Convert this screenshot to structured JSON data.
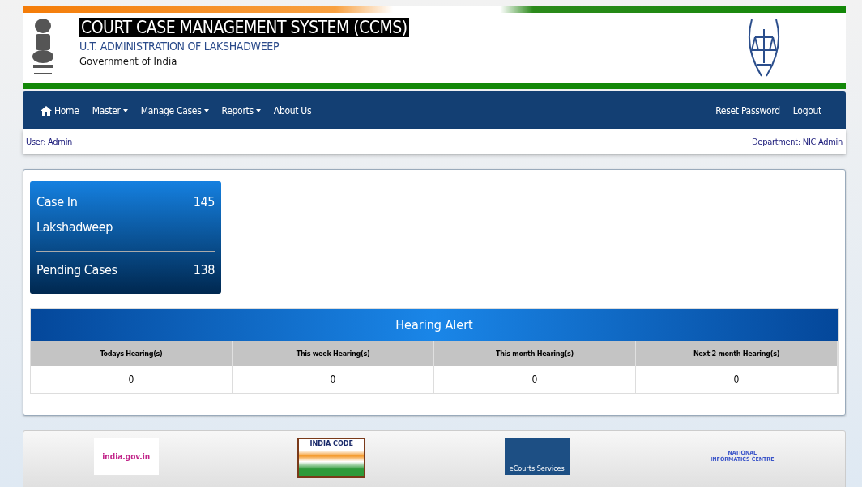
{
  "header": {
    "title": "COURT CASE MANAGEMENT SYSTEM (CCMS)",
    "subtitle": "U.T. ADMINISTRATION OF LAKSHADWEEP",
    "government": "Government of India"
  },
  "nav": {
    "left": [
      {
        "label": "Home",
        "kind": "home"
      },
      {
        "label": "Master",
        "kind": "dropdown"
      },
      {
        "label": "Manage Cases",
        "kind": "dropdown"
      },
      {
        "label": "Reports",
        "kind": "dropdown"
      },
      {
        "label": "About Us",
        "kind": "link"
      }
    ],
    "right": [
      {
        "label": "Reset Password"
      },
      {
        "label": "Logout"
      }
    ]
  },
  "user_bar": {
    "user": "User: Admin",
    "department": "Department: NIC Admin"
  },
  "stats": [
    {
      "label": "Case In Lakshadweep",
      "value": "145"
    },
    {
      "label": "Pending Cases",
      "value": "138"
    }
  ],
  "hearing_alert": {
    "title": "Hearing Alert",
    "columns": [
      "Todays Hearing(s)",
      "This week Hearing(s)",
      "This month Hearing(s)",
      "Next 2 month Hearing(s)"
    ],
    "values": [
      "0",
      "0",
      "0",
      "0"
    ]
  },
  "footer_logos": [
    {
      "kind": "indiagov",
      "text": "india.gov.in"
    },
    {
      "kind": "indiacode",
      "text": "INDIA CODE"
    },
    {
      "kind": "ecourts",
      "text": "eCourts Services"
    },
    {
      "kind": "nic",
      "text": "NATIONAL INFORMATICS CENTRE"
    }
  ]
}
